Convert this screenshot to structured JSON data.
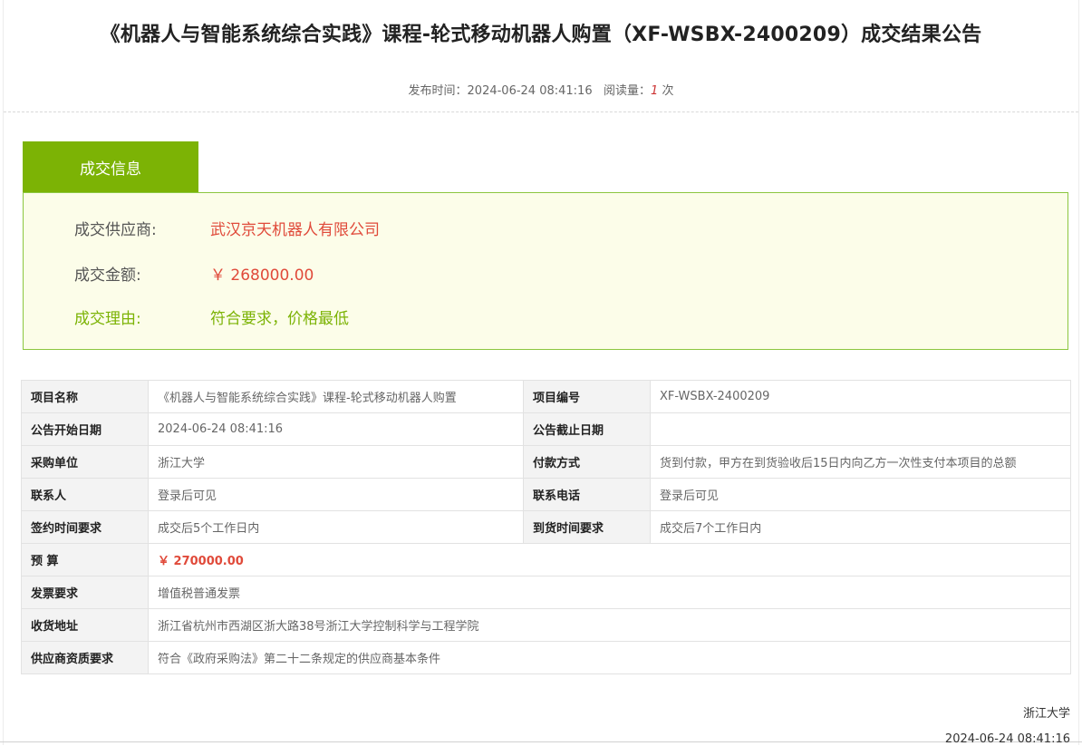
{
  "title": "《机器人与智能系统综合实践》课程-轮式移动机器人购置（XF-WSBX-2400209）成交结果公告",
  "meta": {
    "publish_label": "发布时间：",
    "publish_time": "2024-06-24 08:41:16",
    "views_label": "阅读量：",
    "views_count": "1",
    "views_unit": "次"
  },
  "tab": {
    "label": "成交信息"
  },
  "deal": {
    "supplier_label": "成交供应商:",
    "supplier": "武汉京天机器人有限公司",
    "amount_label": "成交金额:",
    "amount": "￥ 268000.00",
    "reason_label": "成交理由:",
    "reason": "符合要求，价格最低"
  },
  "details": {
    "project_name_label": "项目名称",
    "project_name": "《机器人与智能系统综合实践》课程-轮式移动机器人购置",
    "project_no_label": "项目编号",
    "project_no": "XF-WSBX-2400209",
    "start_date_label": "公告开始日期",
    "start_date": "2024-06-24 08:41:16",
    "end_date_label": "公告截止日期",
    "end_date": "",
    "purchaser_label": "采购单位",
    "purchaser": "浙江大学",
    "payment_label": "付款方式",
    "payment": "货到付款，甲方在到货验收后15日内向乙方一次性支付本项目的总额",
    "contact_label": "联系人",
    "contact": "登录后可见",
    "phone_label": "联系电话",
    "phone": "登录后可见",
    "sign_time_label": "签约时间要求",
    "sign_time": "成交后5个工作日内",
    "delivery_time_label": "到货时间要求",
    "delivery_time": "成交后7个工作日内",
    "budget_label": "预 算",
    "budget": "￥ 270000.00",
    "invoice_label": "发票要求",
    "invoice": "增值税普通发票",
    "address_label": "收货地址",
    "address": "浙江省杭州市西湖区浙大路38号浙江大学控制科学与工程学院",
    "qualification_label": "供应商资质要求",
    "qualification": "符合《政府采购法》第二十二条规定的供应商基本条件"
  },
  "footer": {
    "org": "浙江大学",
    "date": "2024-06-24 08:41:16"
  },
  "colors": {
    "accent_green": "#7cb305",
    "box_border": "#8cc63f",
    "box_bg": "#fcfde9",
    "price_red": "#e04a3a"
  }
}
